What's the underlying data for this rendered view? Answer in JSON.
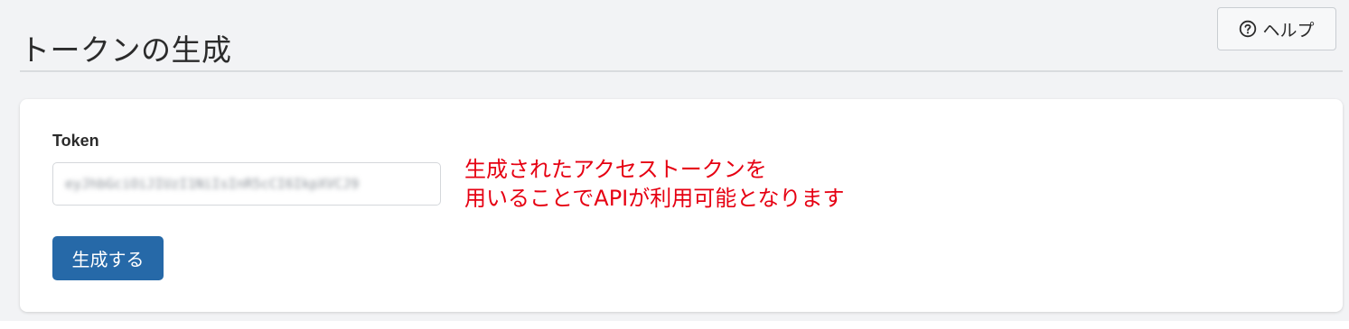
{
  "header": {
    "title": "トークンの生成",
    "help_button": {
      "icon": "question-circle-icon",
      "label": "ヘルプ"
    }
  },
  "form": {
    "token_label": "Token",
    "token_value": "eyJhbGciOiJIUzI1NiIsInR5cCI6IkpXVCJ9",
    "generate_button_label": "生成する"
  },
  "annotation": {
    "line1": "生成されたアクセストークンを",
    "line2": "用いることでAPIが利用可能となります",
    "color": "#e60012"
  },
  "colors": {
    "page_background": "#f2f3f5",
    "primary_button": "#2669a8",
    "card_background": "#ffffff"
  }
}
